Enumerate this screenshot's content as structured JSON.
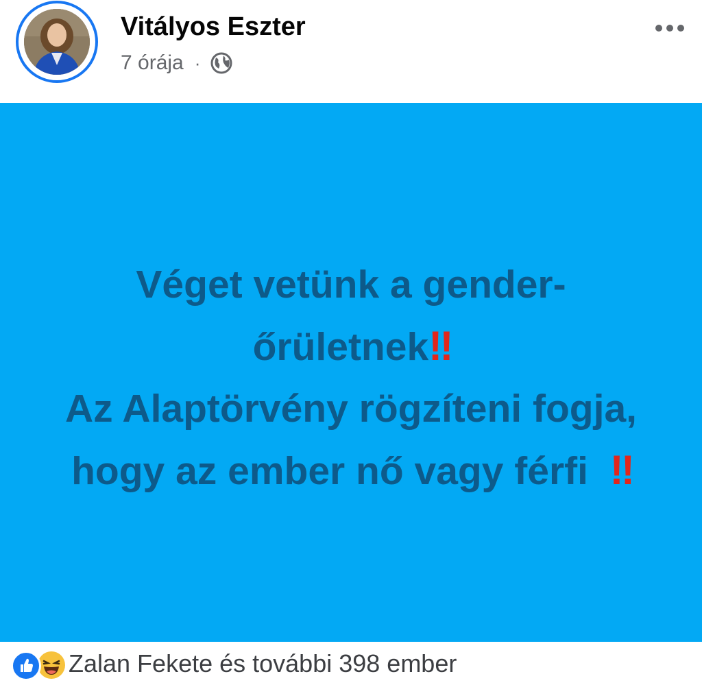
{
  "post": {
    "author_name": "Vitályos Eszter",
    "timestamp": "7 órája",
    "separator": "·",
    "privacy_icon": "globe-icon",
    "more_icon": "more-options-icon",
    "content": {
      "background_color": "#03a9f4",
      "text_color": "#0d5a8a",
      "lines": [
        "Véget vetünk a gender-",
        "őrületnek",
        "Az Alaptörvény rögzíteni fogja,",
        "hogy az ember nő vagy férfi"
      ],
      "emphasis": "‼",
      "emphasis_color": "#e2261c"
    }
  },
  "reactions": {
    "icons": [
      "like-icon",
      "haha-icon"
    ],
    "summary": "Zalan Fekete és további 398 ember"
  },
  "colors": {
    "accent": "#1877f2",
    "secondary_text": "#65676b"
  }
}
